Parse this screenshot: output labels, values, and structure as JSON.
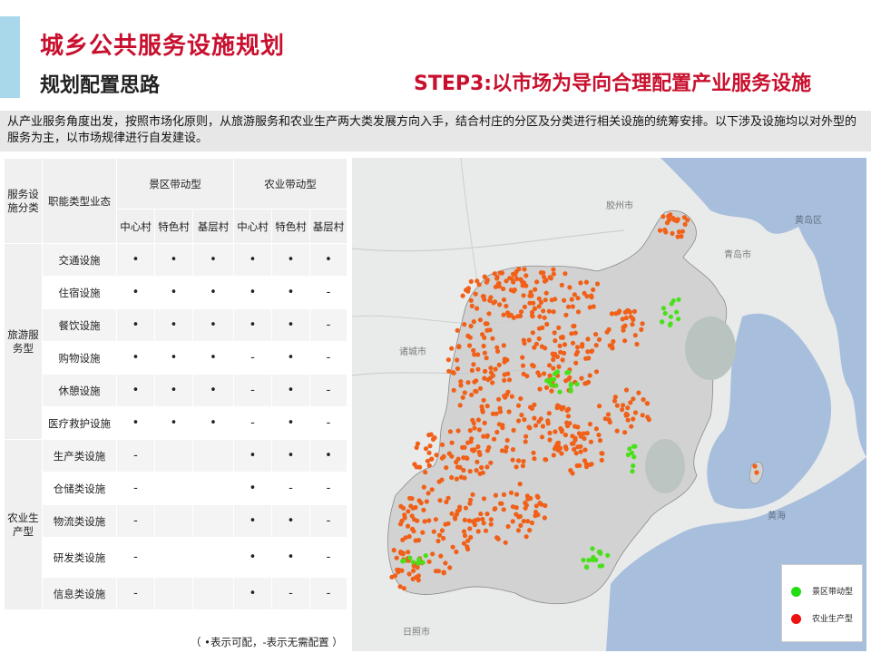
{
  "header": {
    "title": "城乡公共服务设施规划",
    "subtitle": "规划配置思路",
    "step": "STEP3:以市场为导向合理配置产业服务设施"
  },
  "intro": "从产业服务角度出发，按照市场化原则，从旅游服务和农业生产两大类发展方向入手，结合村庄的分区及分类进行相关设施的统筹安排。以下涉及设施均以对外型的服务为主，以市场规律进行自发建设。",
  "table": {
    "head_category": "服务设施分类",
    "head_type": "职能类型业态",
    "group1": "景区带动型",
    "group2": "农业带动型",
    "cols": [
      "中心村",
      "特色村",
      "基层村",
      "中心村",
      "特色村",
      "基层村"
    ],
    "sections": [
      {
        "category": "旅游服务型",
        "rows": [
          {
            "name": "交通设施",
            "values": [
              "•",
              "•",
              "•",
              "•",
              "•",
              "•"
            ]
          },
          {
            "name": "住宿设施",
            "values": [
              "•",
              "•",
              "•",
              "•",
              "•",
              "-"
            ]
          },
          {
            "name": "餐饮设施",
            "values": [
              "•",
              "•",
              "•",
              "•",
              "•",
              "-"
            ]
          },
          {
            "name": "购物设施",
            "values": [
              "•",
              "•",
              "•",
              "-",
              "•",
              "-"
            ]
          },
          {
            "name": "休憩设施",
            "values": [
              "•",
              "•",
              "•",
              "-",
              "•",
              "-"
            ]
          },
          {
            "name": "医疗救护设施",
            "values": [
              "•",
              "•",
              "•",
              "-",
              "•",
              "-"
            ]
          }
        ]
      },
      {
        "category": "农业生产型",
        "rows": [
          {
            "name": "生产类设施",
            "values": [
              "-",
              "",
              "",
              "•",
              "•",
              "•"
            ]
          },
          {
            "name": "仓储类设施",
            "values": [
              "-",
              "",
              "",
              "•",
              "-",
              "-"
            ]
          },
          {
            "name": "物流类设施",
            "values": [
              "-",
              "",
              "",
              "•",
              "•",
              "-"
            ]
          },
          {
            "name": "研发类设施",
            "values": [
              "-",
              "",
              "",
              "•",
              "•",
              "-"
            ]
          },
          {
            "name": "信息类设施",
            "values": [
              "-",
              "",
              "",
              "•",
              "-",
              "-"
            ]
          }
        ]
      }
    ],
    "note": "（ •表示可配，-表示无需配置 ）"
  },
  "map": {
    "labels": [
      "胶州市",
      "黄岛区",
      "诸城市",
      "青岛市",
      "黄海",
      "日照市"
    ],
    "legend": [
      {
        "label": "景区带动型",
        "color": "#22dd11"
      },
      {
        "label": "农业生产型",
        "color": "#ee1111"
      }
    ],
    "colors": {
      "land": "#e9eaea",
      "study_area": "#d2d2d2",
      "sea": "#a7bfdc",
      "orange_dot": "#f06018",
      "green_dot": "#49e01a"
    }
  }
}
